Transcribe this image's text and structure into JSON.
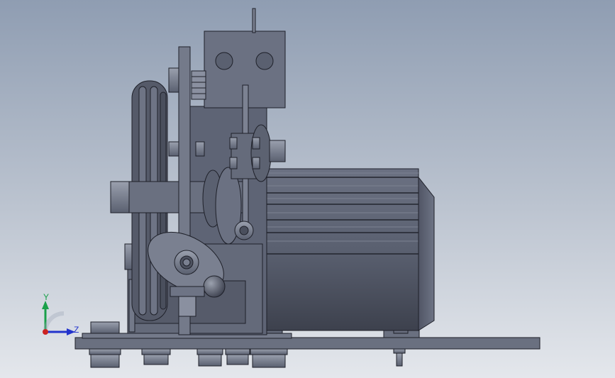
{
  "viewport": {
    "background_top": "#8f9db2",
    "background_bottom": "#e4e7ec"
  },
  "model": {
    "part_color": "#5e6475",
    "part_dark": "#3f4452",
    "part_light": "#8a90a0",
    "edge_color": "#1e2029"
  },
  "triad": {
    "y_label": "Y",
    "z_label": "Z",
    "y_color": "#1aa04a",
    "z_color": "#2233cc",
    "x_color": "#cc2222"
  }
}
